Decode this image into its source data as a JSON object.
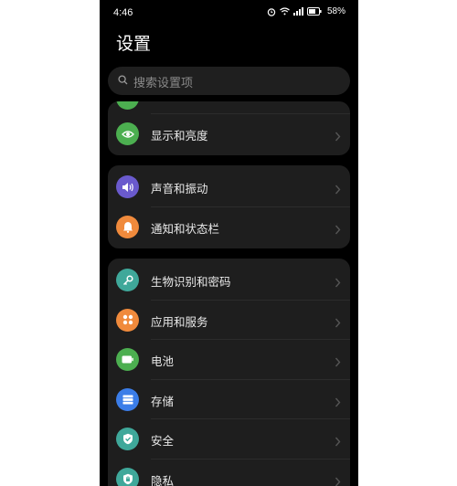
{
  "status_bar": {
    "time": "4:46",
    "battery_percent": "58%",
    "icons": [
      "alarm-icon",
      "wifi-icon",
      "signal-icon",
      "battery-icon"
    ]
  },
  "header": {
    "title": "设置"
  },
  "search": {
    "placeholder": "搜索设置项"
  },
  "groups": [
    {
      "items": [
        {
          "label": "显示和亮度",
          "icon": "eye-icon",
          "color": "#4caf50"
        }
      ]
    },
    {
      "items": [
        {
          "label": "声音和振动",
          "icon": "speaker-icon",
          "color": "#6a5acd"
        },
        {
          "label": "通知和状态栏",
          "icon": "bell-icon",
          "color": "#f08a3c"
        }
      ]
    },
    {
      "items": [
        {
          "label": "生物识别和密码",
          "icon": "key-icon",
          "color": "#3fa89a"
        },
        {
          "label": "应用和服务",
          "icon": "apps-grid-icon",
          "color": "#f08a3c"
        },
        {
          "label": "电池",
          "icon": "battery-icon",
          "color": "#4caf50"
        },
        {
          "label": "存储",
          "icon": "storage-icon",
          "color": "#3b7de8"
        },
        {
          "label": "安全",
          "icon": "shield-check-icon",
          "color": "#3fa89a"
        },
        {
          "label": "隐私",
          "icon": "privacy-shield-icon",
          "color": "#3fa89a"
        }
      ]
    }
  ]
}
